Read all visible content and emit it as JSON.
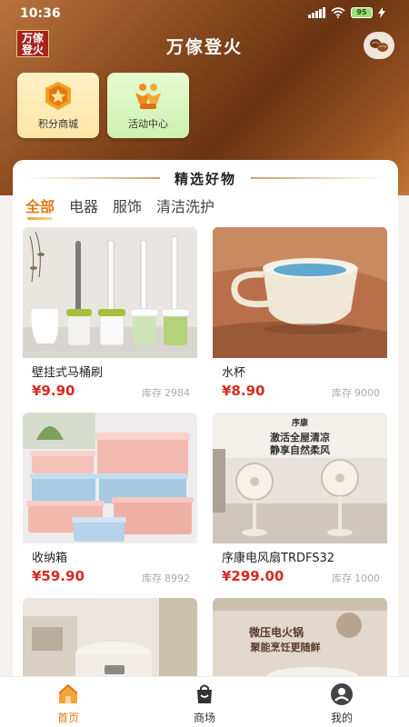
{
  "status_bar": {
    "time": "10:36",
    "battery": "95"
  },
  "header": {
    "logo_text_line1": "万傢",
    "logo_text_line2": "登火",
    "title": "万傢登火"
  },
  "quick_entries": [
    {
      "label": "积分商城",
      "icon": "points-mall-icon"
    },
    {
      "label": "活动中心",
      "icon": "activity-center-icon"
    }
  ],
  "section": {
    "title": "精选好物"
  },
  "tabs": [
    {
      "label": "全部",
      "active": true
    },
    {
      "label": "电器",
      "active": false
    },
    {
      "label": "服饰",
      "active": false
    },
    {
      "label": "清洁洗护",
      "active": false
    }
  ],
  "stock_label": "库存",
  "products": [
    {
      "name": "壁挂式马桶刷",
      "price": "¥9.90",
      "stock": "2984"
    },
    {
      "name": "水杯",
      "price": "¥8.90",
      "stock": "9000"
    },
    {
      "name": "收纳箱",
      "price": "¥59.90",
      "stock": "8992"
    },
    {
      "name": "序康电风扇TRDFS32",
      "price": "¥299.00",
      "stock": "1000"
    }
  ],
  "product_image_text": {
    "fan_brand": "序康",
    "fan_slogan1": "激活全屋清凉",
    "fan_slogan2": "静享自然柔风",
    "cooker_slogan1": "微压电火锅",
    "cooker_slogan2": "聚能烹饪更随鲜"
  },
  "bottom_nav": [
    {
      "label": "首页",
      "active": true
    },
    {
      "label": "商场",
      "active": false
    },
    {
      "label": "我的",
      "active": false
    }
  ],
  "colors": {
    "accent": "#e07b18",
    "price": "#d62a1e",
    "header_brown": "#8a4a1e"
  }
}
